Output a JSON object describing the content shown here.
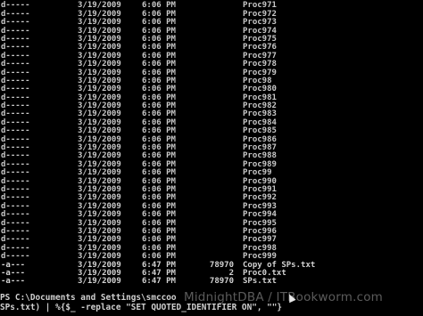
{
  "listing": [
    {
      "mode": "d-----",
      "date": "3/19/2009",
      "time": "6:06 PM",
      "length": "",
      "name": "Proc970"
    },
    {
      "mode": "d-----",
      "date": "3/19/2009",
      "time": "6:06 PM",
      "length": "",
      "name": "Proc971"
    },
    {
      "mode": "d-----",
      "date": "3/19/2009",
      "time": "6:06 PM",
      "length": "",
      "name": "Proc972"
    },
    {
      "mode": "d-----",
      "date": "3/19/2009",
      "time": "6:06 PM",
      "length": "",
      "name": "Proc973"
    },
    {
      "mode": "d-----",
      "date": "3/19/2009",
      "time": "6:06 PM",
      "length": "",
      "name": "Proc974"
    },
    {
      "mode": "d-----",
      "date": "3/19/2009",
      "time": "6:06 PM",
      "length": "",
      "name": "Proc975"
    },
    {
      "mode": "d-----",
      "date": "3/19/2009",
      "time": "6:06 PM",
      "length": "",
      "name": "Proc976"
    },
    {
      "mode": "d-----",
      "date": "3/19/2009",
      "time": "6:06 PM",
      "length": "",
      "name": "Proc977"
    },
    {
      "mode": "d-----",
      "date": "3/19/2009",
      "time": "6:06 PM",
      "length": "",
      "name": "Proc978"
    },
    {
      "mode": "d-----",
      "date": "3/19/2009",
      "time": "6:06 PM",
      "length": "",
      "name": "Proc979"
    },
    {
      "mode": "d-----",
      "date": "3/19/2009",
      "time": "6:06 PM",
      "length": "",
      "name": "Proc98"
    },
    {
      "mode": "d-----",
      "date": "3/19/2009",
      "time": "6:06 PM",
      "length": "",
      "name": "Proc980"
    },
    {
      "mode": "d-----",
      "date": "3/19/2009",
      "time": "6:06 PM",
      "length": "",
      "name": "Proc981"
    },
    {
      "mode": "d-----",
      "date": "3/19/2009",
      "time": "6:06 PM",
      "length": "",
      "name": "Proc982"
    },
    {
      "mode": "d-----",
      "date": "3/19/2009",
      "time": "6:06 PM",
      "length": "",
      "name": "Proc983"
    },
    {
      "mode": "d-----",
      "date": "3/19/2009",
      "time": "6:06 PM",
      "length": "",
      "name": "Proc984"
    },
    {
      "mode": "d-----",
      "date": "3/19/2009",
      "time": "6:06 PM",
      "length": "",
      "name": "Proc985"
    },
    {
      "mode": "d-----",
      "date": "3/19/2009",
      "time": "6:06 PM",
      "length": "",
      "name": "Proc986"
    },
    {
      "mode": "d-----",
      "date": "3/19/2009",
      "time": "6:06 PM",
      "length": "",
      "name": "Proc987"
    },
    {
      "mode": "d-----",
      "date": "3/19/2009",
      "time": "6:06 PM",
      "length": "",
      "name": "Proc988"
    },
    {
      "mode": "d-----",
      "date": "3/19/2009",
      "time": "6:06 PM",
      "length": "",
      "name": "Proc989"
    },
    {
      "mode": "d-----",
      "date": "3/19/2009",
      "time": "6:06 PM",
      "length": "",
      "name": "Proc99"
    },
    {
      "mode": "d-----",
      "date": "3/19/2009",
      "time": "6:06 PM",
      "length": "",
      "name": "Proc990"
    },
    {
      "mode": "d-----",
      "date": "3/19/2009",
      "time": "6:06 PM",
      "length": "",
      "name": "Proc991"
    },
    {
      "mode": "d-----",
      "date": "3/19/2009",
      "time": "6:06 PM",
      "length": "",
      "name": "Proc992"
    },
    {
      "mode": "d-----",
      "date": "3/19/2009",
      "time": "6:06 PM",
      "length": "",
      "name": "Proc993"
    },
    {
      "mode": "d-----",
      "date": "3/19/2009",
      "time": "6:06 PM",
      "length": "",
      "name": "Proc994"
    },
    {
      "mode": "d-----",
      "date": "3/19/2009",
      "time": "6:06 PM",
      "length": "",
      "name": "Proc995"
    },
    {
      "mode": "d-----",
      "date": "3/19/2009",
      "time": "6:06 PM",
      "length": "",
      "name": "Proc996"
    },
    {
      "mode": "d-----",
      "date": "3/19/2009",
      "time": "6:06 PM",
      "length": "",
      "name": "Proc997"
    },
    {
      "mode": "d-----",
      "date": "3/19/2009",
      "time": "6:06 PM",
      "length": "",
      "name": "Proc998"
    },
    {
      "mode": "d-----",
      "date": "3/19/2009",
      "time": "6:06 PM",
      "length": "",
      "name": "Proc999"
    },
    {
      "mode": "-a---",
      "date": "3/19/2009",
      "time": "6:47 PM",
      "length": "78970",
      "name": "Copy of SPs.txt"
    },
    {
      "mode": "-a---",
      "date": "3/19/2009",
      "time": "6:47 PM",
      "length": "2",
      "name": "Proc0.txt"
    },
    {
      "mode": "-a---",
      "date": "3/19/2009",
      "time": "6:47 PM",
      "length": "78970",
      "name": "SPs.txt"
    }
  ],
  "command": {
    "line1": "PS C:\\Documents and Settings\\smccoo",
    "line2": "SPs.txt) | %{$_ -replace \"SET QUOTED_IDENTIFIER ON\", \"\"}"
  },
  "watermark": "MidnightDBA / ITBookworm.com",
  "colors": {
    "background": "#000000",
    "text": "#c8c8c8"
  },
  "icons": {
    "cursor": "mouse-pointer-icon"
  }
}
